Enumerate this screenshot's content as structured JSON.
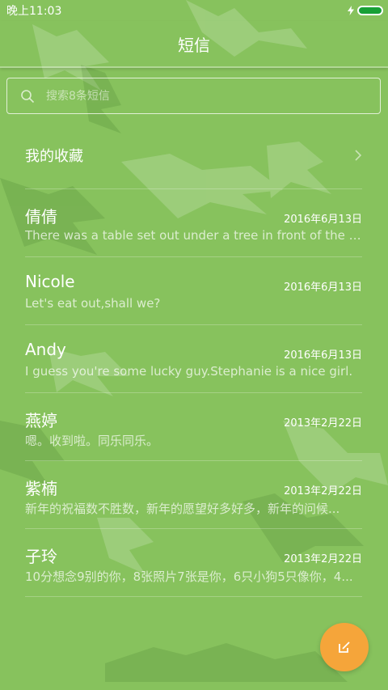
{
  "status_bar": {
    "time": "晚上11:03"
  },
  "header": {
    "title": "短信"
  },
  "search": {
    "placeholder": "搜索8条短信"
  },
  "favorites": {
    "label": "我的收藏"
  },
  "conversations": [
    {
      "name": "倩倩",
      "date": "2016年6月13日",
      "preview": "There was a table set out under a tree in front of the ho..."
    },
    {
      "name": "Nicole",
      "date": "2016年6月13日",
      "preview": "Let's eat out,shall we?"
    },
    {
      "name": "Andy",
      "date": "2016年6月13日",
      "preview": "I guess you're some lucky guy.Stephanie is a nice girl."
    },
    {
      "name": "燕婷",
      "date": "2013年2月22日",
      "preview": "嗯。收到啦。同乐同乐。"
    },
    {
      "name": "紫楠",
      "date": "2013年2月22日",
      "preview": "新年的祝福数不胜数，新年的愿望好多好多，新年的问候..."
    },
    {
      "name": "子玲",
      "date": "2013年2月22日",
      "preview": "10分想念9别的你，8张照片7张是你，6只小狗5只像你，4..."
    }
  ],
  "colors": {
    "background": "#87c25d",
    "fab": "#f5a53a",
    "battery": "#18a036"
  }
}
